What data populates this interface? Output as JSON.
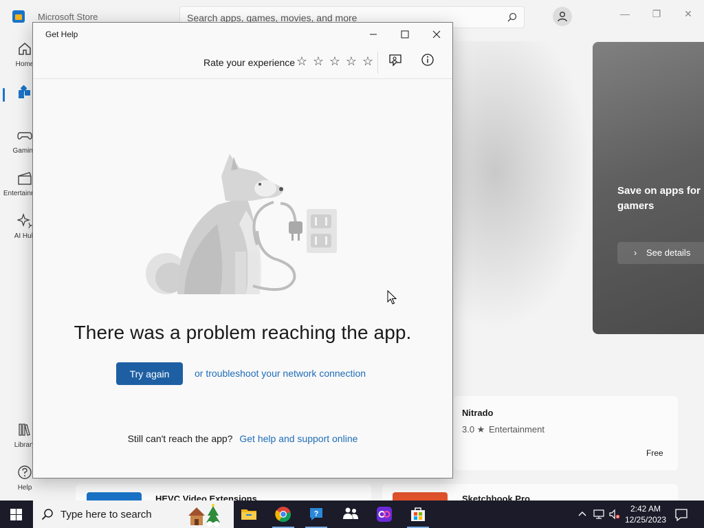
{
  "store": {
    "title": "Microsoft Store",
    "search_placeholder": "Search apps, games, movies, and more",
    "window_controls": {
      "minimize": "—",
      "restore": "❐",
      "close": "✕"
    },
    "nav": [
      {
        "label": "Home"
      },
      {
        "label": ""
      },
      {
        "label": "Gaming"
      },
      {
        "label": "Entertainment"
      },
      {
        "label": "AI Hub"
      },
      {
        "label": "Library"
      },
      {
        "label": "Help"
      }
    ],
    "hero": {
      "text": "Save on apps for gamers",
      "button": "See details"
    },
    "cards": [
      {
        "title": "Nitrado",
        "rating": "3.0 ★",
        "category": "Entertainment",
        "price": "Free"
      },
      {
        "title": "HEVC Video Extensions"
      },
      {
        "title": "Sketchbook Pro"
      }
    ],
    "accent_color": "#1a73c7"
  },
  "dialog": {
    "title": "Get Help",
    "rate_label": "Rate your experience",
    "stars": [
      "☆",
      "☆",
      "☆",
      "☆",
      "☆"
    ],
    "error_title": "There was a problem reaching the app.",
    "try_again": "Try again",
    "troubleshoot_link": "or troubleshoot your network connection",
    "still_text": "Still can't reach the app?",
    "support_link": "Get help and support online",
    "button_color": "#1e5fa3",
    "link_color": "#1e6cb8"
  },
  "taskbar": {
    "search_placeholder": "Type here to search",
    "time": "2:42 AM",
    "date": "12/25/2023",
    "apps": [
      "file-explorer-icon",
      "chrome-icon",
      "get-help-icon",
      "teams-icon",
      "game-app-icon",
      "store-icon"
    ]
  }
}
